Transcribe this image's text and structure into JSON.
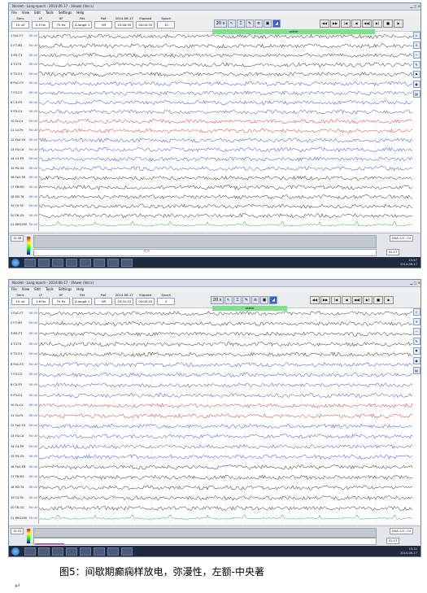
{
  "screenshots": [
    {
      "window_title": "Nicolet - Long epoch - 2014-06-17 - Viewer (Ver.x)",
      "menu": [
        "File",
        "View",
        "Edit",
        "Tools",
        "Settings",
        "Help"
      ],
      "toolbar": {
        "fields": [
          {
            "label": "Sens",
            "value": "10 uV"
          },
          {
            "label": "LF",
            "value": "0.5 Hz"
          },
          {
            "label": "HF",
            "value": "70 Hz"
          },
          {
            "label": "Pat",
            "value": "A-longit 1"
          },
          {
            "label": "Ref",
            "value": "Off"
          },
          {
            "label": "2014-06-17",
            "value": "15:46:35"
          },
          {
            "label": "Elapsed",
            "value": "00:00:35"
          },
          {
            "label": "Epoch",
            "value": "10"
          }
        ],
        "zoom": "20 s",
        "nav_buttons": [
          "◀◀",
          "▶▶",
          "|◀",
          "◀",
          "◀◀|",
          "▶|",
          "■",
          "▶"
        ]
      },
      "marker_label": "active",
      "channels": [
        "1 Fp1-F7",
        "2 F7-M1",
        "3 M1-T3",
        "4 T3-T5",
        "5 T5-O1",
        "6 Fp1-F3",
        "7 F3-C3",
        "8 C3-P3",
        "9 P3-O1",
        "10 Fz-Cz",
        "11 Cz-Pz",
        "12 Fp2-F4",
        "13 F4-C4",
        "14 C4-P4",
        "15 P4-O2",
        "16 Fp2-F8",
        "17 F8-M2",
        "18 M2-T4",
        "19 T4-T6",
        "20 T6-O2",
        "21 EKG-EM"
      ],
      "bottom": {
        "time_left": "15:36",
        "time_right": "02:17",
        "montage": "DSA: C3 - C4"
      },
      "clock": {
        "time": "15:47",
        "date": "2014-06-17"
      }
    },
    {
      "window_title": "Nicolet - Long epoch - 2014-06-17 - Viewer (Ver.x)",
      "menu": [
        "File",
        "View",
        "Edit",
        "Tools",
        "Settings",
        "Help"
      ],
      "toolbar": {
        "fields": [
          {
            "label": "Sens",
            "value": "10 uV"
          },
          {
            "label": "LF",
            "value": "1.6 Hz"
          },
          {
            "label": "HF",
            "value": "70 Hz"
          },
          {
            "label": "Pat",
            "value": "A-longit 1"
          },
          {
            "label": "Ref",
            "value": "Off"
          },
          {
            "label": "2014-06-17",
            "value": "15:31:23"
          },
          {
            "label": "Elapsed",
            "value": "00:00:43"
          },
          {
            "label": "Epoch",
            "value": "5"
          }
        ],
        "zoom": "20 s",
        "nav_buttons": [
          "◀◀",
          "▶▶",
          "|◀",
          "◀",
          "◀◀|",
          "▶|",
          "■",
          "▶"
        ]
      },
      "marker_label": "active",
      "channels": [
        "1 Fp1-F7",
        "2 F7-M1",
        "3 M1-T3",
        "4 T3-T5",
        "5 T5-O1",
        "6 Fp1-F3",
        "7 F3-C3",
        "8 C3-P3",
        "9 P3-O1",
        "10 Fz-Cz",
        "11 Cz-Pz",
        "12 Fp2-F4",
        "13 F4-C4",
        "14 C4-P4",
        "15 P4-O2",
        "16 Fp2-F8",
        "17 F8-M2",
        "18 M2-T4",
        "19 T4-T6",
        "20 T6-O2",
        "21 EKG-EM"
      ],
      "bottom": {
        "time_left": "15:31",
        "time_right": "02:17",
        "montage": "DSA: C3 - C4"
      },
      "clock": {
        "time": "15:31",
        "date": "2014-06-17"
      }
    }
  ],
  "sensitivity_label": "50 uV",
  "caption": "图5：间歇期癫痫样放电，弥漫性，左额-中央著",
  "return_mark": "↵",
  "colors": {
    "black": "#222222",
    "blue": "#2a3fd6",
    "red": "#d42a2a",
    "green": "#3aa04a"
  }
}
